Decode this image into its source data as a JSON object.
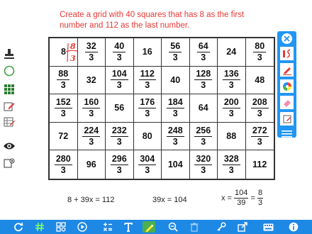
{
  "prompt": {
    "line1": "Create a grid with 40 squares that has 8 as the first",
    "line2": "number and 112 as the last number."
  },
  "grid": {
    "rows": [
      [
        {
          "whole": "8"
        },
        {
          "num": "32",
          "den": "3"
        },
        {
          "num": "40",
          "den": "3"
        },
        {
          "whole": "16"
        },
        {
          "num": "56",
          "den": "3"
        },
        {
          "num": "64",
          "den": "3"
        },
        {
          "whole": "24"
        },
        {
          "num": "80",
          "den": "3"
        }
      ],
      [
        {
          "num": "88",
          "den": "3"
        },
        {
          "whole": "32"
        },
        {
          "num": "104",
          "den": "3"
        },
        {
          "num": "112",
          "den": "3"
        },
        {
          "whole": "40"
        },
        {
          "num": "128",
          "den": "3"
        },
        {
          "num": "136",
          "den": "3"
        },
        {
          "whole": "48"
        }
      ],
      [
        {
          "num": "152",
          "den": "3"
        },
        {
          "num": "160",
          "den": "3"
        },
        {
          "whole": "56"
        },
        {
          "num": "176",
          "den": "3"
        },
        {
          "num": "184",
          "den": "3"
        },
        {
          "whole": "64"
        },
        {
          "num": "200",
          "den": "3"
        },
        {
          "num": "208",
          "den": "3"
        }
      ],
      [
        {
          "whole": "72"
        },
        {
          "num": "224",
          "den": "3"
        },
        {
          "num": "232",
          "den": "3"
        },
        {
          "whole": "80"
        },
        {
          "num": "248",
          "den": "3"
        },
        {
          "num": "256",
          "den": "3"
        },
        {
          "whole": "88"
        },
        {
          "num": "272",
          "den": "3"
        }
      ],
      [
        {
          "num": "280",
          "den": "3"
        },
        {
          "whole": "96"
        },
        {
          "num": "296",
          "den": "3"
        },
        {
          "num": "304",
          "den": "3"
        },
        {
          "whole": "104"
        },
        {
          "num": "320",
          "den": "3"
        },
        {
          "num": "328",
          "den": "3"
        },
        {
          "whole": "112"
        }
      ]
    ]
  },
  "equations": {
    "eq1": "8 + 39x = 112",
    "eq2": "39x = 104",
    "eq3_lhs": "x =",
    "eq3_num1": "104",
    "eq3_den1": "39",
    "eq3_eq": "=",
    "eq3_num2": "8",
    "eq3_den2": "3"
  },
  "handwriting": {
    "num": "8",
    "den": "3"
  },
  "colors": {
    "accent": "#2196f3",
    "toolbar": "#1e88e5",
    "prompt_text": "#e53935",
    "handwriting": "#e53935",
    "highlight_tool": "#4caf50"
  },
  "icons": {
    "left": [
      "stamp-icon",
      "circle-icon",
      "grid-icon",
      "edit-box-icon",
      "table-edit-icon",
      "eye-icon",
      "eye-box-icon"
    ],
    "panel": [
      "close-icon",
      "pen-color-icon",
      "highlighter-icon",
      "color-wheel-icon",
      "eraser-icon",
      "note-icon",
      "menu-icon"
    ],
    "bottom": [
      "refresh-icon",
      "hash-icon",
      "grid-settings-icon",
      "play-icon",
      "operations-icon",
      "text-tool-icon",
      "pen-tool-icon",
      "zoom-out-icon",
      "trash-icon",
      "key-icon",
      "share-icon",
      "keyboard-icon",
      "info-icon"
    ]
  }
}
